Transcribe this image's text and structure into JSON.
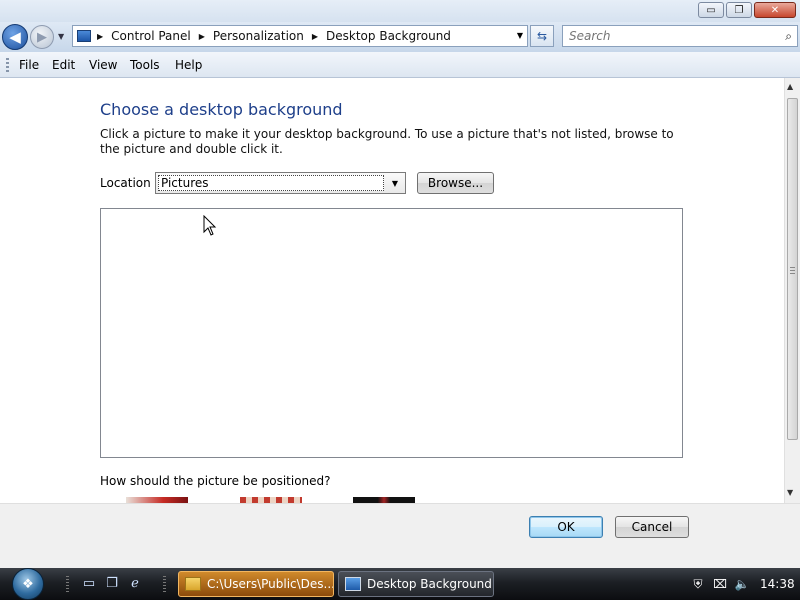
{
  "window": {
    "buttons": {
      "minimize": "▭",
      "maximize": "❐",
      "close": "✕"
    }
  },
  "nav": {
    "breadcrumbs": [
      "Control Panel",
      "Personalization",
      "Desktop Background"
    ],
    "search_placeholder": "Search"
  },
  "menu": {
    "file": "File",
    "edit": "Edit",
    "view": "View",
    "tools": "Tools",
    "help": "Help"
  },
  "main": {
    "heading": "Choose a desktop background",
    "description": "Click a picture to make it your desktop background. To use a picture that's not listed, browse to the picture and double click it.",
    "location_label": "Location",
    "location_value": "Pictures",
    "browse_label": "Browse...",
    "position_question": "How should the picture be positioned?"
  },
  "footer": {
    "ok_label": "OK",
    "cancel_label": "Cancel"
  },
  "taskbar": {
    "tasks": [
      {
        "label": "C:\\Users\\Public\\Des...",
        "icon": "folder-icon",
        "active": false
      },
      {
        "label": "Desktop Background",
        "icon": "desktop-icon",
        "active": true
      }
    ],
    "clock": "14:38"
  },
  "colors": {
    "heading": "#1e3f8a",
    "ok_border": "#3c7fb1",
    "taskbar": "#1c1f24",
    "folder_task": "#d08a2c"
  }
}
